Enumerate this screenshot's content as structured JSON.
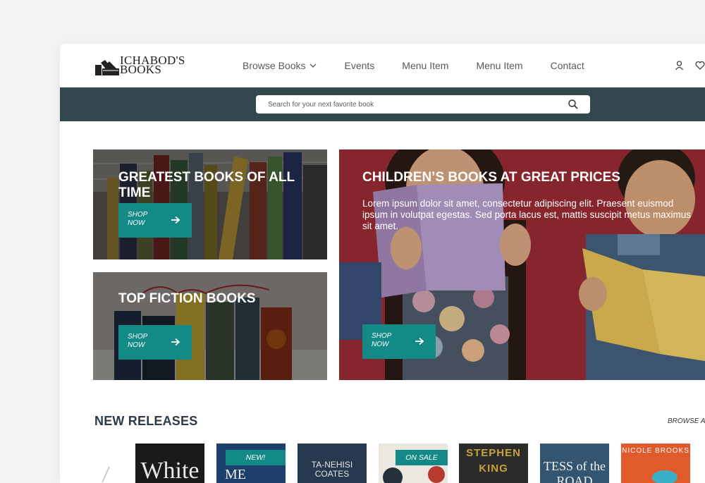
{
  "brand": {
    "line1": "ICHABOD'S",
    "line2": "BOOKS"
  },
  "nav": {
    "items": [
      "Browse Books",
      "Events",
      "Menu Item",
      "Menu Item",
      "Contact"
    ]
  },
  "header_icons": [
    "user-icon",
    "heart-icon"
  ],
  "search": {
    "placeholder": "Search for your next favorite book"
  },
  "tiles": {
    "greatest": {
      "title": "GREATEST BOOKS OF ALL TIME",
      "button": "SHOP NOW"
    },
    "fiction": {
      "title": "TOP FICTION BOOKS",
      "button": "SHOP NOW"
    },
    "children": {
      "title": "CHILDREN’S BOOKS AT GREAT PRICES",
      "body": "Lorem ipsum dolor sit amet, consectetur adipiscing elit. Praesent euismod ipsum in volutpat egestas. Sed porta lacus est, mattis suscipit metus maximus sit amet.",
      "button": "SHOP NOW"
    }
  },
  "new_releases": {
    "title": "NEW RELEASES",
    "browse_all": "BROWSE A",
    "books": [
      {
        "cover_text": "White",
        "badge": ""
      },
      {
        "cover_text": "ME",
        "badge": "NEW!"
      },
      {
        "cover_text": "TA-NEHISI COATES",
        "badge": ""
      },
      {
        "cover_text": "",
        "badge": "ON SALE"
      },
      {
        "cover_text": "STEPHEN KING",
        "badge": ""
      },
      {
        "cover_text": "TESS of the ROAD",
        "badge": ""
      },
      {
        "cover_text": "NICOLE BROOKS",
        "badge": ""
      }
    ]
  },
  "colors": {
    "accent": "#138a85",
    "band": "#34474f",
    "heading": "#2e3a46"
  }
}
